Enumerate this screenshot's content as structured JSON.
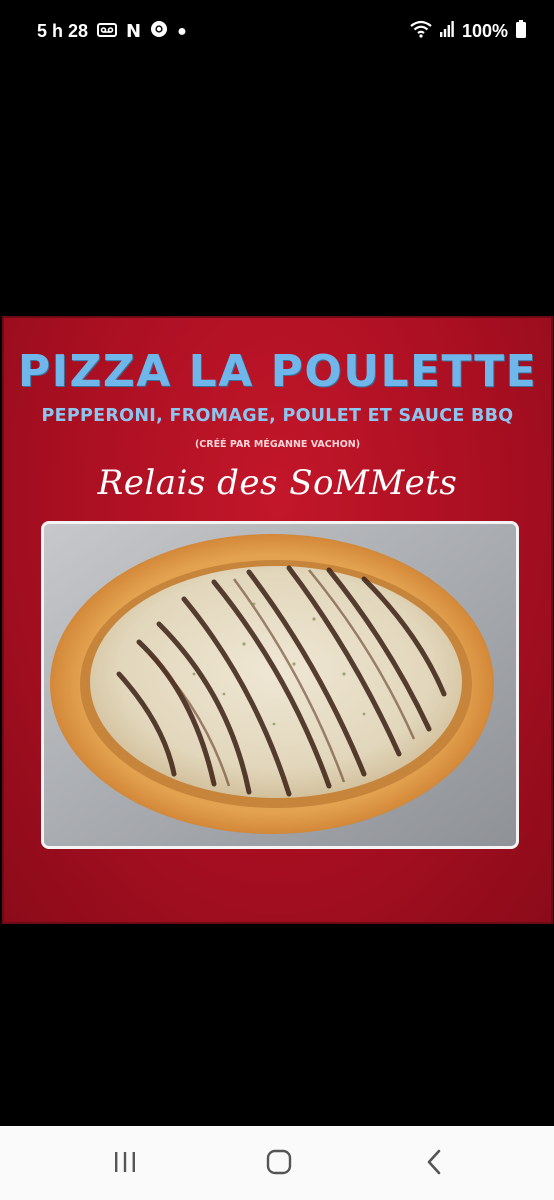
{
  "status_bar": {
    "time": "5 h 28",
    "notification_letter": "N",
    "battery": "100%",
    "icons": [
      "voicemail-icon",
      "netflix-icon",
      "chrome-icon",
      "more-dot-icon",
      "wifi-icon",
      "signal-icon",
      "battery-icon"
    ]
  },
  "post": {
    "title": "PIZZA LA POULETTE",
    "subtitle": "PEPPERONI, FROMAGE, POULET ET SAUCE BBQ",
    "credit": "(CRÉÉ PAR MÉGANNE VACHON)",
    "brand": "Relais des SoMMets",
    "colors": {
      "background": "#b01024",
      "title": "#6fb6ea",
      "subtitle": "#8cc6f0"
    }
  },
  "nav_bar": {
    "icons": [
      "recents-icon",
      "home-icon",
      "back-icon"
    ]
  }
}
